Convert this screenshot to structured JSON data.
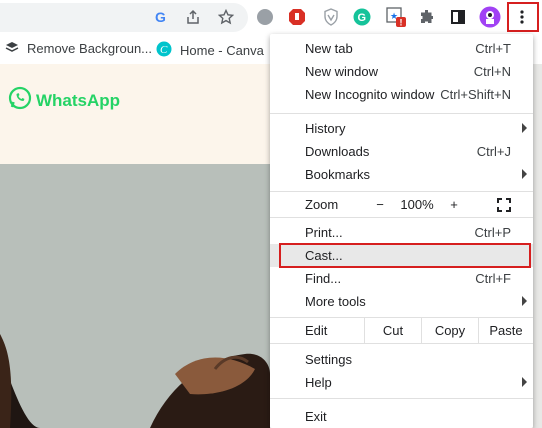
{
  "menu": {
    "new_tab": {
      "label": "New tab",
      "shortcut": "Ctrl+T"
    },
    "new_window": {
      "label": "New window",
      "shortcut": "Ctrl+N"
    },
    "new_incognito": {
      "label": "New Incognito window",
      "shortcut": "Ctrl+Shift+N"
    },
    "history": {
      "label": "History"
    },
    "downloads": {
      "label": "Downloads",
      "shortcut": "Ctrl+J"
    },
    "bookmarks": {
      "label": "Bookmarks"
    },
    "zoom": {
      "label": "Zoom",
      "minus": "−",
      "level": "100%",
      "plus": "+"
    },
    "print": {
      "label": "Print...",
      "shortcut": "Ctrl+P"
    },
    "cast": {
      "label": "Cast..."
    },
    "find": {
      "label": "Find...",
      "shortcut": "Ctrl+F"
    },
    "more_tools": {
      "label": "More tools"
    },
    "edit": {
      "label": "Edit",
      "cut": "Cut",
      "copy": "Copy",
      "paste": "Paste"
    },
    "settings": {
      "label": "Settings"
    },
    "help": {
      "label": "Help"
    },
    "exit": {
      "label": "Exit"
    }
  },
  "bookmarks_bar": {
    "items": [
      {
        "label": "Remove Backgroun...",
        "icon": "layers-icon"
      },
      {
        "label": "Home - Canva",
        "icon": "canva-icon"
      }
    ]
  },
  "page": {
    "logo_text": "WhatsApp"
  },
  "colors": {
    "highlight_box": "#d61f1f",
    "whatsapp_green": "#25d366",
    "header_bg": "#fcf5eb"
  }
}
